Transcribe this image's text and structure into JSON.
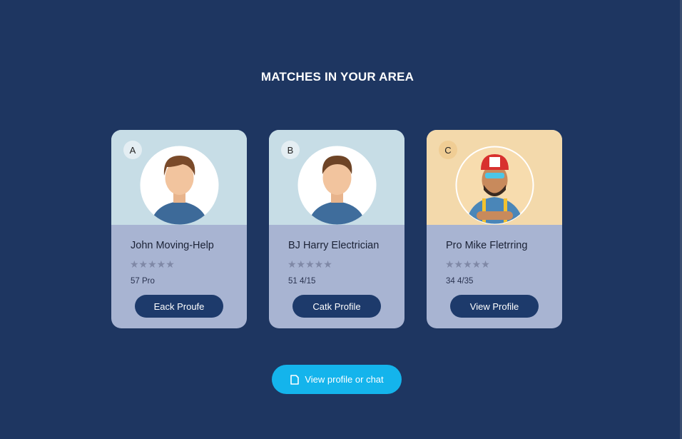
{
  "header": {
    "title": "MATCHES IN YOUR AREA"
  },
  "cards": [
    {
      "badge": "A",
      "name": "John Moving-Help",
      "stars": "★★★★★",
      "meta": "57 Pro",
      "button": "Eack Proufe"
    },
    {
      "badge": "B",
      "name": "BJ Harry Electrician",
      "stars": "★★★★★",
      "meta": "51 4/15",
      "button": "Catk Profile"
    },
    {
      "badge": "C",
      "name": "Pro Mike Fletrring",
      "stars": "★★★★★",
      "meta": "34 4/35",
      "button": "View Profile"
    }
  ],
  "cta": {
    "label": "View profile or chat",
    "icon": "document-icon"
  },
  "colors": {
    "background": "#1e3661",
    "card_button": "#1d3a6b",
    "cta": "#14b4ec"
  }
}
